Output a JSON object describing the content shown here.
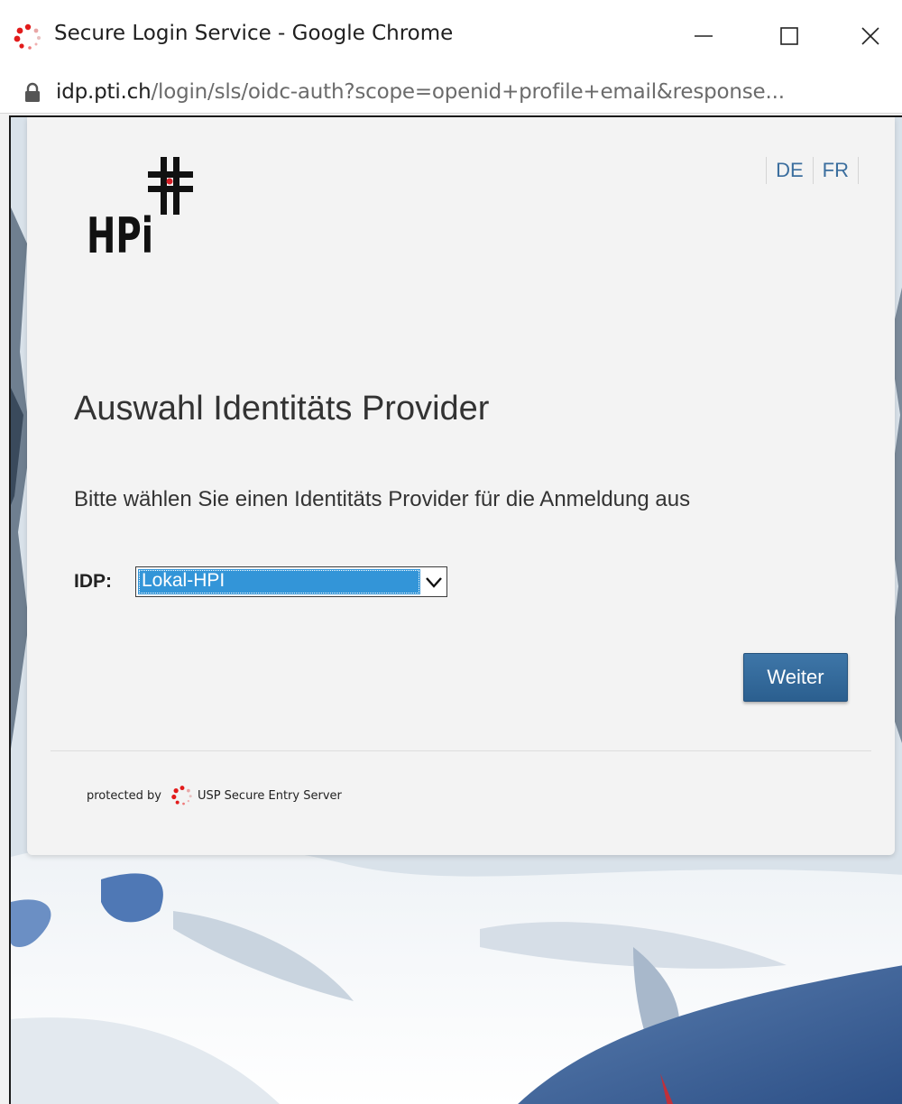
{
  "browser": {
    "window_title": "Secure Login Service - Google Chrome",
    "url_host": "idp.pti.ch",
    "url_path": "/login/sls/oidc-auth?scope=openid+profile+email&response..."
  },
  "card": {
    "language_links": [
      "DE",
      "FR"
    ],
    "title": "Auswahl Identitäts Provider",
    "instruction": "Bitte wählen Sie einen Identitäts Provider für die Anmeldung aus",
    "idp_label": "IDP:",
    "idp_selected": "Lokal-HPI",
    "submit_label": "Weiter",
    "footer_prefix": "protected by",
    "footer_product": "USP Secure Entry Server"
  },
  "logo_text": "HPi",
  "colors": {
    "link": "#3b6e9e",
    "button": "#2f6494",
    "select_highlight": "#3395d8",
    "card_background": "#f3f3f3"
  },
  "icons": {
    "app": "usp-dots-icon",
    "lock": "lock-icon",
    "minimize": "minimize-icon",
    "maximize": "maximize-icon",
    "close": "close-icon",
    "dropdown": "chevron-down-icon"
  }
}
